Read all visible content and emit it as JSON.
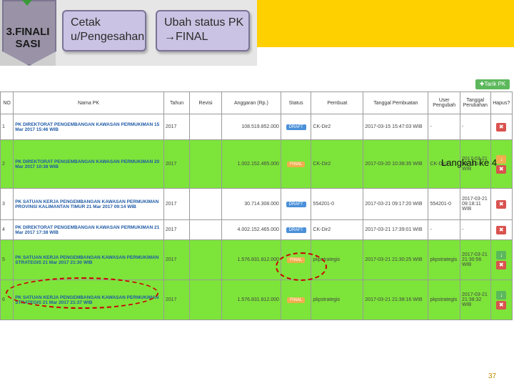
{
  "step": {
    "label_1": "3.FINALI",
    "label_2": "SASI"
  },
  "actions": [
    {
      "line1": "Cetak",
      "line2": "u/Pengesahan"
    },
    {
      "line1": "Ubah status PK",
      "line2": "→FINAL"
    }
  ],
  "add_button": "✚Tarik PK",
  "columns": [
    "NO",
    "Nama PK",
    "Tahun",
    "Revisi",
    "Anggaran (Rp.)",
    "Status",
    "Pembuat",
    "Tanggal Pembuatan",
    "User Pengubah",
    "Tanggal Perubahan",
    "Hapus?"
  ],
  "rows": [
    {
      "no": "1",
      "nama": "PK DIREKTORAT PENGEMBANGAN KAWASAN PERMUKIMAN 15 Mar 2017 15:46 WIB",
      "tahun": "2017",
      "revisi": "",
      "anggaran": "108.519.852.000",
      "status": "DRAFT",
      "pembuat": "CK-Dir2",
      "tgl": "2017-03-15 15:47:03 WIB",
      "user": "-",
      "tglubah": "-",
      "style": "white"
    },
    {
      "no": "2",
      "nama": "PK DIREKTORAT PENGEMBANGAN KAWASAN PERMUKIMAN 20 Mar 2017 10:38 WIB",
      "tahun": "2017",
      "revisi": "",
      "anggaran": "1.002.152.465.000",
      "status": "FINAL",
      "pembuat": "CK-Dir2",
      "tgl": "2017-03-20 10:38:35 WIB",
      "user": "CK-Dir2",
      "tglubah": "2017-03-21 14:15:18 WIB",
      "style": "green"
    },
    {
      "no": "3",
      "nama": "PK SATUAN KERJA PENGEMBANGAN KAWASAN PERMUKIMAN PROVINSI KALIMANTAN TIMUR 21 Mar 2017 09:14 WIB",
      "tahun": "2017",
      "revisi": "",
      "anggaran": "30.714.308.000",
      "status": "DRAFT",
      "pembuat": "554201-0",
      "tgl": "2017-03-21 09:17:20 WIB",
      "user": "554201-0",
      "tglubah": "2017-03-21 09:18:11 WIB",
      "style": "white"
    },
    {
      "no": "4",
      "nama": "PK DIREKTORAT PENGEMBANGAN KAWASAN PERMUKIMAN 21 Mar 2017 17:38 WIB",
      "tahun": "2017",
      "revisi": "",
      "anggaran": "4.002.152.465.000",
      "status": "DRAFT",
      "pembuat": "CK-Dir2",
      "tgl": "2017-03-21 17:39:01 WIB",
      "user": "-",
      "tglubah": "-",
      "style": "white"
    },
    {
      "no": "5",
      "nama": "PK SATUAN KERJA PENGEMBANGAN KAWASAN PERMUKIMAN STRATEGIS 21 Mar 2017 21:30 WIB",
      "tahun": "2017",
      "revisi": "",
      "anggaran": "1.576.831.812.000",
      "status": "FINAL",
      "pembuat": "pkpstrategis",
      "tgl": "2017-03-21 21:30:25 WIB",
      "user": "pkpstrategis",
      "tglubah": "2017-03-21 21:30:56 WIB",
      "style": "green"
    },
    {
      "no": "6",
      "nama": "PK SATUAN KERJA PENGEMBANGAN KAWASAN PERMUKIMAN STRATEGIS 21 Mar 2017 21:37 WIB",
      "tahun": "2017",
      "revisi": "",
      "anggaran": "1.576.831.812.000",
      "status": "FINAL",
      "pembuat": "pkpstrategis",
      "tgl": "2017-03-21 21:38:16 WIB",
      "user": "pkpstrategis",
      "tglubah": "2017-03-21 21:38:32 WIB",
      "style": "green"
    }
  ],
  "annotation": "Langkah ke 4",
  "page_number": "37",
  "colors": {
    "accent_green": "#7de43a",
    "accent_yellow": "#ffd000",
    "final": "#f0ad4e",
    "draft": "#4a90d9"
  }
}
